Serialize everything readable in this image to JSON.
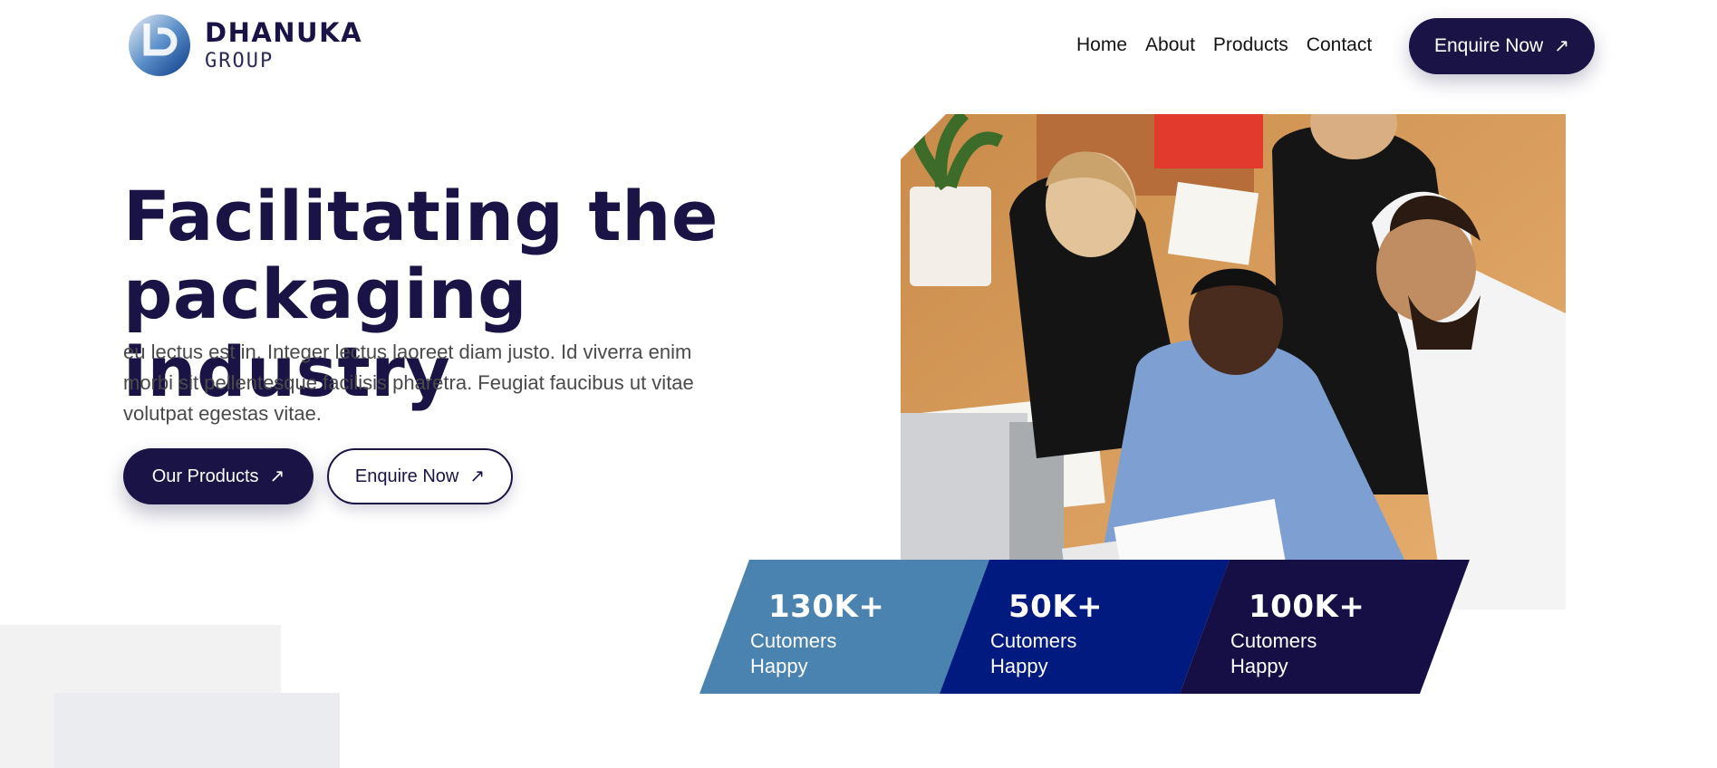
{
  "brand": {
    "name": "DHANUKA",
    "sub": "GROUP"
  },
  "nav": {
    "items": [
      "Home",
      "About",
      "Products",
      "Contact"
    ]
  },
  "header": {
    "cta_label": "Enquire Now",
    "cta_icon": "arrow-up-right-icon"
  },
  "hero": {
    "title_line1": "Facilitating the",
    "title_line2": "packaging industry",
    "description": "eu lectus est in. Integer lectus laoreet diam justo. Id viverra enim morbi sit pellentesque facilisis pharetra. Feugiat faucibus ut vitae volutpat egestas vitae.",
    "primary_button": "Our Products",
    "secondary_button": "Enquire Now"
  },
  "stats": [
    {
      "value": "130K+",
      "label_line1": "Cutomers",
      "label_line2": "Happy",
      "color": "#4a82b0"
    },
    {
      "value": "50K+",
      "label_line1": "Cutomers",
      "label_line2": "Happy",
      "color": "#001a7f"
    },
    {
      "value": "100K+",
      "label_line1": "Cutomers",
      "label_line2": "Happy",
      "color": "#150f45"
    }
  ],
  "colors": {
    "primary": "#1a1446",
    "text": "#4a4a4a",
    "background": "#ffffff"
  }
}
